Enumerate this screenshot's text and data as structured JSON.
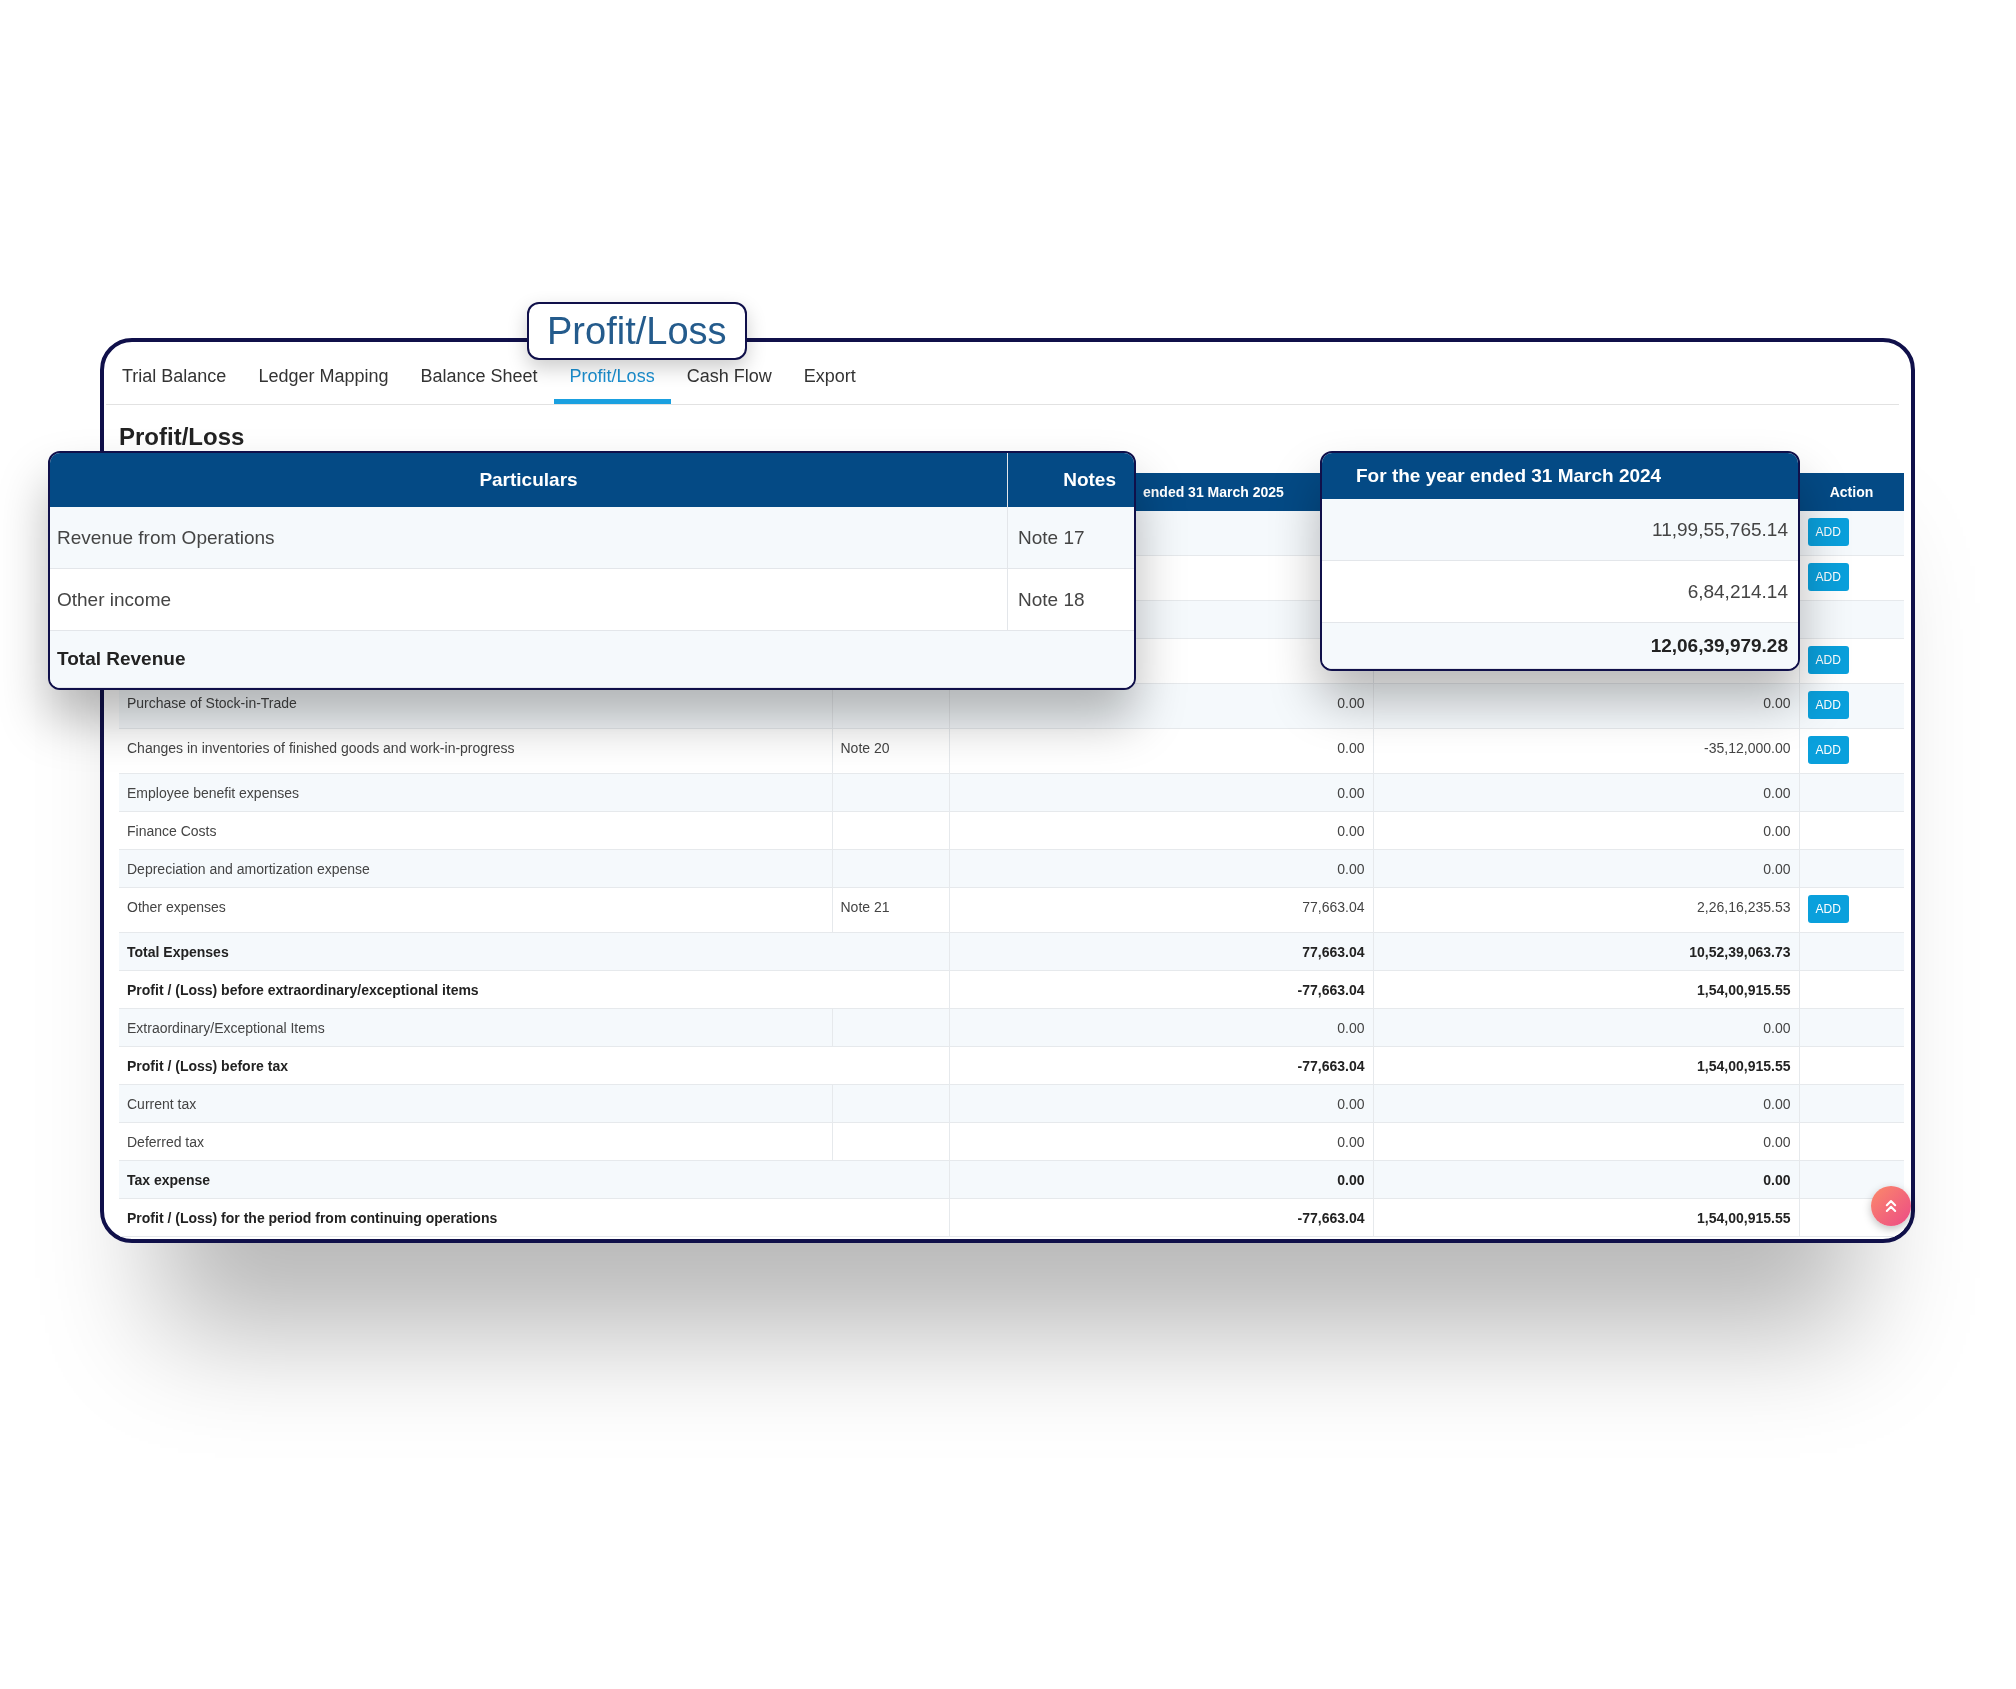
{
  "tabs": [
    {
      "label": "Trial Balance",
      "selected": false
    },
    {
      "label": "Ledger Mapping",
      "selected": false
    },
    {
      "label": "Balance Sheet",
      "selected": false
    },
    {
      "label": "Profit/Loss",
      "selected": true
    },
    {
      "label": "Cash Flow",
      "selected": false
    },
    {
      "label": "Export",
      "selected": false
    }
  ],
  "heading": "Profit/Loss",
  "table": {
    "header_2025": "ended 31 March 2025",
    "header_action": "Action",
    "rows": [
      {
        "kind": "covered",
        "action": "ADD"
      },
      {
        "kind": "covered",
        "action": "ADD"
      },
      {
        "kind": "covered_blank"
      },
      {
        "kind": "covered",
        "action": "ADD"
      },
      {
        "kind": "item",
        "particular": "Purchase of Stock-in-Trade",
        "value_2025": "0.00",
        "value_2024": "0.00",
        "action": "ADD"
      },
      {
        "kind": "item",
        "particular": "Changes in inventories of finished goods and work-in-progress",
        "note": "Note 20",
        "value_2025": "0.00",
        "value_2024": "-35,12,000.00",
        "action": "ADD"
      },
      {
        "kind": "item",
        "particular": "Employee benefit expenses",
        "value_2025": "0.00",
        "value_2024": "0.00"
      },
      {
        "kind": "item",
        "particular": "Finance Costs",
        "value_2025": "0.00",
        "value_2024": "0.00"
      },
      {
        "kind": "item",
        "particular": "Depreciation and amortization expense",
        "value_2025": "0.00",
        "value_2024": "0.00"
      },
      {
        "kind": "item",
        "particular": "Other expenses",
        "note": "Note 21",
        "value_2025": "77,663.04",
        "value_2024": "2,26,16,235.53",
        "action": "ADD"
      },
      {
        "kind": "total",
        "particular": "Total Expenses",
        "value_2025": "77,663.04",
        "value_2024": "10,52,39,063.73"
      },
      {
        "kind": "total",
        "particular": "Profit / (Loss) before extraordinary/exceptional items",
        "value_2025": "-77,663.04",
        "value_2024": "1,54,00,915.55"
      },
      {
        "kind": "item",
        "particular": "Extraordinary/Exceptional Items",
        "value_2025": "0.00",
        "value_2024": "0.00"
      },
      {
        "kind": "total",
        "particular": "Profit / (Loss) before tax",
        "value_2025": "-77,663.04",
        "value_2024": "1,54,00,915.55"
      },
      {
        "kind": "item",
        "particular": "Current tax",
        "value_2025": "0.00",
        "value_2024": "0.00"
      },
      {
        "kind": "item",
        "particular": "Deferred tax",
        "value_2025": "0.00",
        "value_2024": "0.00"
      },
      {
        "kind": "total",
        "particular": "Tax expense",
        "value_2025": "0.00",
        "value_2024": "0.00"
      },
      {
        "kind": "total",
        "particular": "Profit / (Loss) for the period from continuing operations",
        "value_2025": "-77,663.04",
        "value_2024": "1,54,00,915.55"
      }
    ]
  },
  "callouts": {
    "tab_label": "Profit/Loss",
    "particulars": {
      "columns": [
        "Particulars",
        "Notes"
      ],
      "rows": [
        {
          "label": "Revenue from Operations",
          "note": "Note 17",
          "bold": false
        },
        {
          "label": "Other income",
          "note": "Note 18",
          "bold": false
        },
        {
          "label": "Total Revenue",
          "bold": true
        }
      ]
    },
    "year_2024": {
      "title": "For the year ended 31 March 2024",
      "rows": [
        {
          "value": "11,99,55,765.14",
          "bold": false
        },
        {
          "value": "6,84,214.14",
          "bold": false
        },
        {
          "value": "12,06,39,979.28",
          "bold": true
        }
      ]
    }
  }
}
